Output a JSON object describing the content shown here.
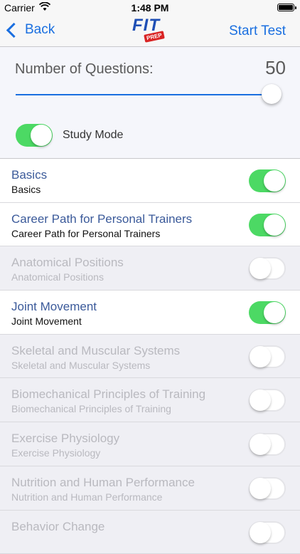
{
  "status": {
    "carrier": "Carrier",
    "time": "1:48 PM"
  },
  "nav": {
    "back_label": "Back",
    "logo_text": "FIT",
    "logo_badge": "PREP",
    "start_label": "Start Test"
  },
  "settings": {
    "questions_label": "Number of Questions:",
    "questions_value": "50",
    "slider_fraction": 1.0,
    "study_mode_label": "Study Mode",
    "study_mode_on": true
  },
  "colors": {
    "accent": "#1a6fe0",
    "toggle_on": "#4cd964",
    "title": "#3b5a9a",
    "disabled_bg": "#efeff4"
  },
  "topics": [
    {
      "title": "Basics",
      "subtitle": "Basics",
      "enabled": true
    },
    {
      "title": "Career Path for Personal Trainers",
      "subtitle": "Career Path for Personal Trainers",
      "enabled": true
    },
    {
      "title": "Anatomical Positions",
      "subtitle": "Anatomical Positions",
      "enabled": false
    },
    {
      "title": "Joint Movement",
      "subtitle": "Joint Movement",
      "enabled": true
    },
    {
      "title": "Skeletal and Muscular Systems",
      "subtitle": "Skeletal and Muscular Systems",
      "enabled": false
    },
    {
      "title": "Biomechanical Principles of Training",
      "subtitle": "Biomechanical Principles of Training",
      "enabled": false
    },
    {
      "title": "Exercise Physiology",
      "subtitle": "Exercise Physiology",
      "enabled": false
    },
    {
      "title": "Nutrition and Human Performance",
      "subtitle": "Nutrition and Human Performance",
      "enabled": false
    },
    {
      "title": "Behavior Change",
      "subtitle": "",
      "enabled": false
    }
  ]
}
